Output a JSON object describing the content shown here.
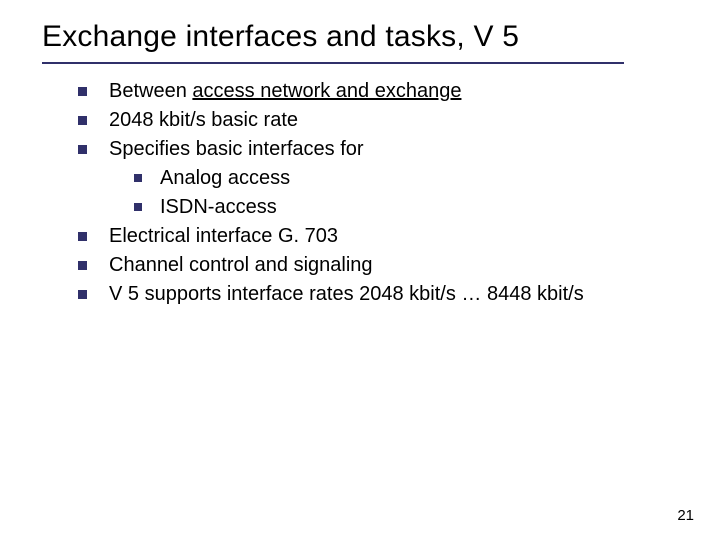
{
  "title": "Exchange interfaces and tasks, V 5",
  "bullets": {
    "b0_pre": "Between ",
    "b0_ul": "access network and exchange",
    "b1": "2048 kbit/s basic rate",
    "b2": "Specifies basic interfaces for",
    "b2_s0": "Analog access",
    "b2_s1": "ISDN-access",
    "b3": "Electrical interface G. 703",
    "b4": "Channel control and signaling",
    "b5": "V 5 supports interface rates 2048 kbit/s … 8448 kbit/s"
  },
  "page_number": "21"
}
